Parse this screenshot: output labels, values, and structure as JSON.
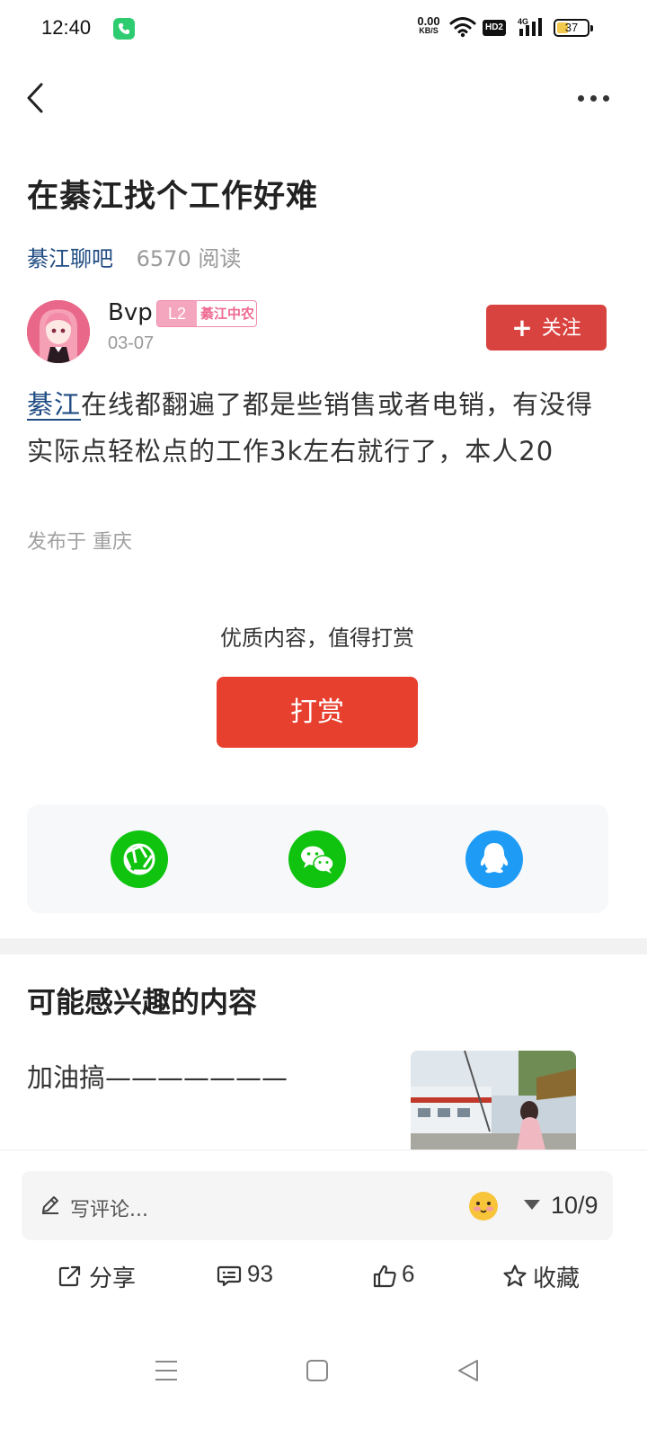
{
  "status_bar": {
    "time": "12:40",
    "net_speed_value": "0.00",
    "net_speed_unit": "KB/S",
    "hd_label": "HD2",
    "network_type": "4G",
    "battery_level": "37"
  },
  "post": {
    "title": "在綦江找个工作好难",
    "forum_name": "綦江聊吧",
    "read_count": "6570 阅读",
    "author": {
      "name": "Bvp",
      "level": "L2",
      "badge_name": "綦江中农",
      "date": "03-07"
    },
    "follow_label": "关注",
    "body_keyword": "綦江",
    "body_text": "在线都翻遍了都是些销售或者电销，有没得实际点轻松点的工作3k左右就行了，本人20",
    "location": "发布于 重庆"
  },
  "reward": {
    "hint": "优质内容，值得打赏",
    "button_label": "打赏"
  },
  "share": {
    "items": [
      "moments-icon",
      "wechat-icon",
      "qq-icon"
    ]
  },
  "recommendations": {
    "title": "可能感兴趣的内容",
    "items": [
      {
        "title": "加油搞———————"
      }
    ]
  },
  "comment_bar": {
    "placeholder": "写评论...",
    "page_indicator": "10/9"
  },
  "actions": {
    "share_label": "分享",
    "comment_count": "93",
    "like_count": "6",
    "favorite_label": "收藏"
  },
  "colors": {
    "accent_red": "#e8402f",
    "follow_red": "#d9433f",
    "link_blue": "#1f4b82",
    "wechat_green": "#0fc30f",
    "qq_blue": "#1e9cf5"
  }
}
